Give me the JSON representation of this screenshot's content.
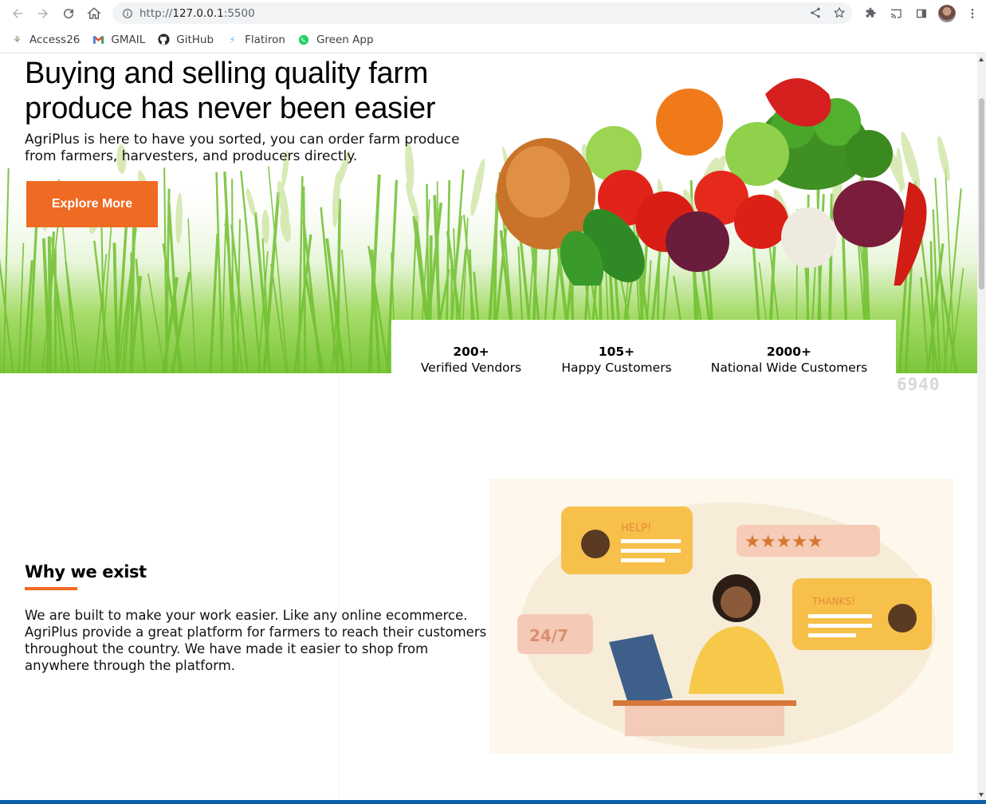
{
  "browser": {
    "url_scheme": "http://",
    "url_host": "127.0.0.1",
    "url_port": ":5500",
    "bookmarks": [
      {
        "label": "Access26",
        "icon": "tree-icon"
      },
      {
        "label": "GMAIL",
        "icon": "gmail-icon"
      },
      {
        "label": "GitHub",
        "icon": "github-icon"
      },
      {
        "label": "Flatiron",
        "icon": "flatiron-icon"
      },
      {
        "label": "Green App",
        "icon": "whatsapp-icon"
      }
    ]
  },
  "hero": {
    "title": "Buying and selling quality farm produce has never been easier",
    "subtitle": "AgriPlus is here to have you sorted, you can order farm produce from farmers, harvesters, and producers directly.",
    "cta_label": "Explore More"
  },
  "stats": [
    {
      "value": "200+",
      "label": "Verified Vendors"
    },
    {
      "value": "105+",
      "label": "Happy Customers"
    },
    {
      "value": "2000+",
      "label": "National Wide Customers"
    }
  ],
  "watermark_number": "6940",
  "why": {
    "title": "Why we exist",
    "body": "We are built to make your work easier. Like any online ecommerce. AgriPlus provide a great platform for farmers to reach their customers throughout the country. We have made it easier to shop from anywhere through the platform."
  },
  "illustration": {
    "bubble_help": "HELP!",
    "bubble_thanks": "THANKS!",
    "badge_24_7": "24/7"
  },
  "colors": {
    "accent": "#ef6a23",
    "grass": "#7cc63a"
  }
}
